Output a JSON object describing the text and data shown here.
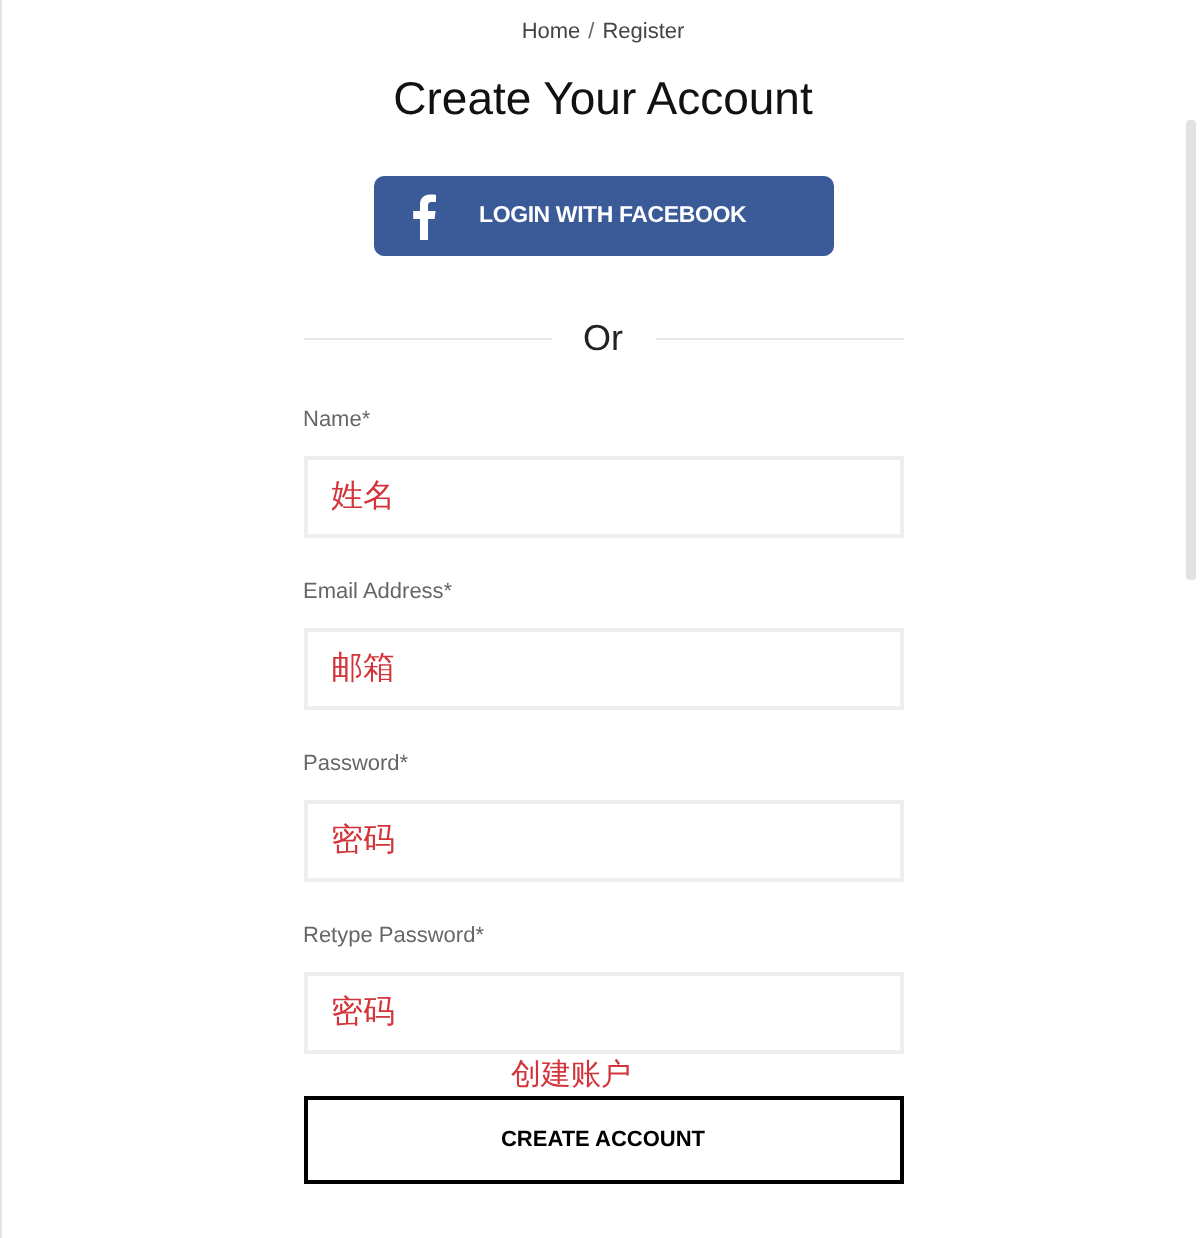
{
  "breadcrumb": {
    "items": [
      {
        "label": "Home"
      },
      {
        "label": "Register"
      }
    ],
    "separator": "/"
  },
  "title": "Create Your Account",
  "facebook_button": {
    "label": "LOGIN WITH FACEBOOK"
  },
  "divider_text": "Or",
  "fields": [
    {
      "label": "Name*",
      "value": "姓名"
    },
    {
      "label": "Email Address*",
      "value": "邮箱"
    },
    {
      "label": "Password*",
      "value": "密码"
    },
    {
      "label": "Retype Password*",
      "value": "密码"
    }
  ],
  "note": "创建账户",
  "submit_button": {
    "label": "CREATE ACCOUNT"
  }
}
